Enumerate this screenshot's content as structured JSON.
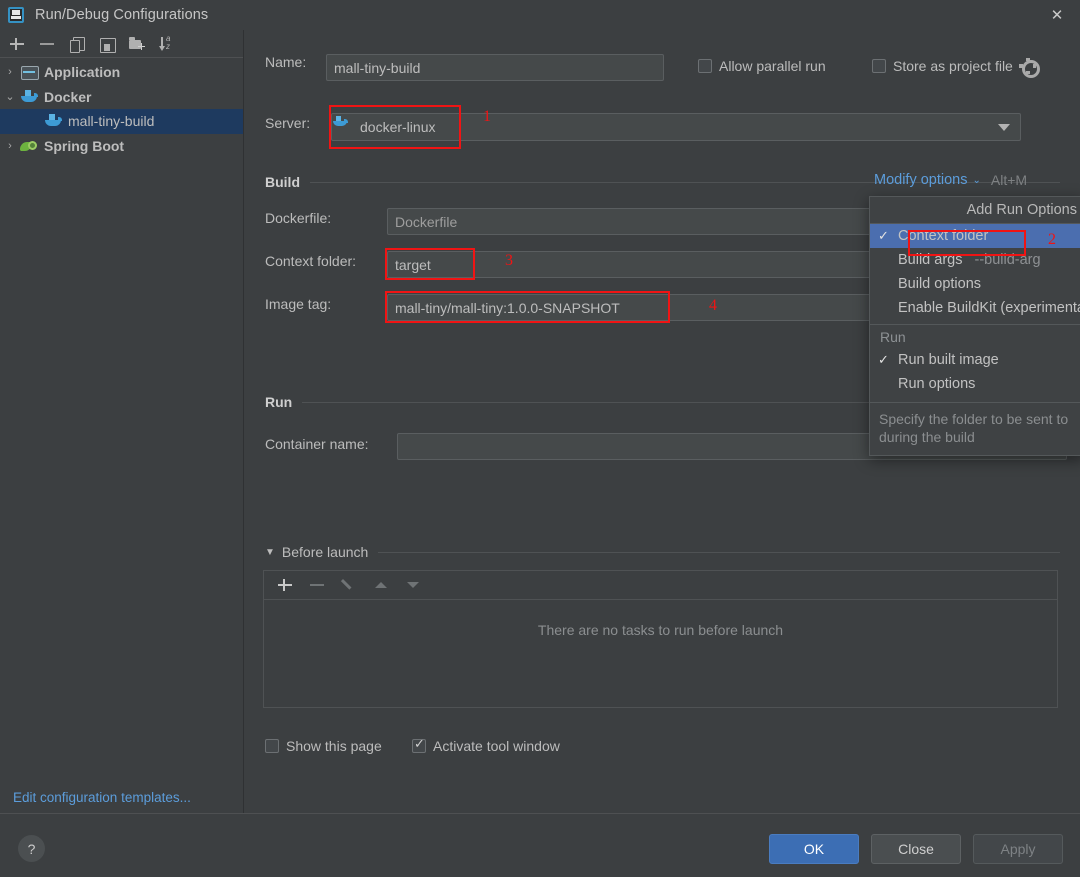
{
  "window": {
    "title": "Run/Debug Configurations",
    "app_icon": "intellij-idea-icon",
    "close_label": "✕"
  },
  "sidebar": {
    "toolbar": [
      {
        "name": "add-configuration-button",
        "icon": "plus-icon"
      },
      {
        "name": "remove-configuration-button",
        "icon": "minus-icon"
      },
      {
        "name": "copy-configuration-button",
        "icon": "copy-icon"
      },
      {
        "name": "save-configuration-button",
        "icon": "save-icon"
      },
      {
        "name": "new-folder-button",
        "icon": "folder-add-icon"
      },
      {
        "name": "sort-configurations-button",
        "icon": "sort-alpha-down-icon"
      }
    ],
    "tree": [
      {
        "label": "Application",
        "icon": "application-window-icon",
        "chevron": "›",
        "expanded": false,
        "selected": false,
        "indent": 0,
        "bold": true
      },
      {
        "label": "Docker",
        "icon": "docker-whale-icon",
        "chevron": "⌄",
        "expanded": true,
        "selected": false,
        "indent": 0,
        "bold": true
      },
      {
        "label": "mall-tiny-build",
        "icon": "docker-whale-icon",
        "chevron": "",
        "expanded": false,
        "selected": true,
        "indent": 1,
        "bold": false
      },
      {
        "label": "Spring Boot",
        "icon": "spring-boot-leaf-icon",
        "chevron": "›",
        "expanded": false,
        "selected": false,
        "indent": 0,
        "bold": true
      }
    ],
    "edit_templates_link": "Edit configuration templates..."
  },
  "form": {
    "name_label": "Name:",
    "name_value": "mall-tiny-build",
    "allow_parallel_run": {
      "label": "Allow parallel run",
      "checked": false
    },
    "store_as_project_file": {
      "label": "Store as project file",
      "checked": false,
      "icon": "gear-icon"
    },
    "server_label": "Server:",
    "server_value": "docker-linux",
    "server_icon": "docker-whale-icon",
    "browse_button": "…",
    "build_section": "Build",
    "dockerfile_label": "Dockerfile:",
    "dockerfile_value": "Dockerfile",
    "context_folder_label": "Context folder:",
    "context_folder_value": "target",
    "image_tag_label": "Image tag:",
    "image_tag_value": "mall-tiny/mall-tiny:1.0.0-SNAPSHOT",
    "run_section": "Run",
    "container_name_label": "Container name:",
    "container_name_value": "",
    "modify_options_link": "Modify options",
    "modify_options_shortcut": "Alt+M"
  },
  "modify_options_popup": {
    "header": "Add Run Options",
    "items": [
      {
        "label": "Context folder",
        "hint": "",
        "checked": true,
        "selected": true,
        "group": ""
      },
      {
        "label": "Build args",
        "hint": "--build-arg",
        "checked": false,
        "selected": false,
        "group": ""
      },
      {
        "label": "Build options",
        "hint": "",
        "checked": false,
        "selected": false,
        "group": ""
      },
      {
        "label": "Enable BuildKit (experimental)",
        "hint": "",
        "checked": false,
        "selected": false,
        "group": ""
      }
    ],
    "run_group_label": "Run",
    "run_items": [
      {
        "label": "Run built image",
        "hint": "",
        "checked": true,
        "selected": false
      },
      {
        "label": "Run options",
        "hint": "",
        "checked": false,
        "selected": false
      }
    ],
    "tooltip_line1": "Specify the folder to be sent to",
    "tooltip_line2": "during the build"
  },
  "before_launch": {
    "section_label": "Before launch",
    "collapse_chevron": "▼",
    "toolbar": [
      {
        "name": "add-task-button",
        "icon": "plus-icon",
        "enabled": true
      },
      {
        "name": "remove-task-button",
        "icon": "minus-icon",
        "enabled": false
      },
      {
        "name": "edit-task-button",
        "icon": "pencil-icon",
        "enabled": false
      },
      {
        "name": "move-task-up-button",
        "icon": "arrow-up-icon",
        "enabled": false
      },
      {
        "name": "move-task-down-button",
        "icon": "arrow-down-icon",
        "enabled": false
      }
    ],
    "empty_message": "There are no tasks to run before launch",
    "show_this_page": {
      "label": "Show this page",
      "checked": false
    },
    "activate_tool_window": {
      "label": "Activate tool window",
      "checked": true
    }
  },
  "footer": {
    "help_label": "?",
    "ok_label": "OK",
    "close_label": "Close",
    "apply_label": "Apply"
  },
  "annotations": [
    {
      "number": "1",
      "target": "server-field"
    },
    {
      "number": "2",
      "target": "context-folder-menu-item"
    },
    {
      "number": "3",
      "target": "context-folder-field"
    },
    {
      "number": "4",
      "target": "image-tag-field"
    }
  ],
  "colors": {
    "window_bg": "#3c3f41",
    "field_bg": "#45494a",
    "selection_blue": "#1e3a5f",
    "menu_selection_blue": "#4b6eaf",
    "link_blue": "#5c9ddb",
    "primary_button": "#3c6eb4",
    "annotation_red": "#f01414",
    "docker_blue": "#3d9bd5",
    "spring_green": "#6db33f"
  }
}
